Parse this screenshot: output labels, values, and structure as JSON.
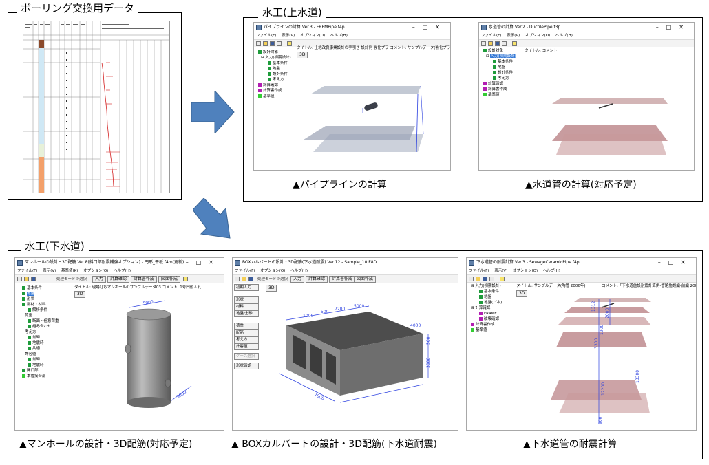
{
  "boring": {
    "title": "ボーリング交換用データ"
  },
  "water_supply": {
    "title": "水工(上水道)",
    "pipeline": {
      "window_title": "パイプラインの計算 Ver.3 - FRPMPipe.f4p",
      "menu": [
        "ファイル(F)",
        "表示(V)",
        "オプション(O)",
        "ヘルプ(H)"
      ],
      "tree": [
        "設計対象",
        "入力(初期設計)",
        "基本条件",
        "地盤",
        "設計条件",
        "考え方",
        "計算確認",
        "計算書作成",
        "基準値"
      ],
      "info_strip": "タイトル: 土地改良事業設計の手引き 設計例  強化プラ  コメント: サンプルデータ(強化プラスチック複合管)",
      "btn_3d": "3D",
      "caption": "▲パイプラインの計算"
    },
    "water_pipe": {
      "window_title": "水道管の計算 Ver.2 - DuctilePipe.f3p",
      "menu": [
        "ファイル(F)",
        "表示(V)",
        "オプション(O)",
        "ヘルプ(H)"
      ],
      "tree": [
        "設計対象",
        "入力(初期設計)",
        "基本条件",
        "地盤",
        "設計条件",
        "考え方",
        "計算確認",
        "計算書作成",
        "基準値"
      ],
      "info_strip": "タイトル:  コメント:",
      "caption": "▲水道管の計算(対応予定)"
    }
  },
  "sewer": {
    "title": "水工(下水道)",
    "manhole": {
      "window_title": "マンホールの設計・3D配筋 Ver.8(斜口部耐震補強オプション) - 円形_平板.f4m(更新)",
      "menu": [
        "ファイル(F)",
        "表示(V)",
        "基準値(K)",
        "オプション(O)",
        "ヘルプ(H)"
      ],
      "mode_label": "処理モードの選択",
      "mode_buttons": [
        "入力",
        "計算確認",
        "計算書作成",
        "図面作成"
      ],
      "info_strip": "タイトル: 現場打ちマンホールのサンプルデータ03  コメント: 1号円形人孔",
      "btn_3d": "3D",
      "tree": [
        "基本条件",
        "地盤",
        "形状",
        "部材・材料",
        "解析条件",
        "荷重",
        "断面・任意荷重",
        "組み合わせ",
        "考え方",
        "常時",
        "地震時",
        "共通",
        "許容値",
        "常時",
        "地震時",
        "開口部",
        "本管接合部"
      ],
      "dims": [
        "5000",
        "3000"
      ],
      "caption": "▲マンホールの設計・3D配筋(対応予定)"
    },
    "box": {
      "window_title": "BOXカルバートの設計・3D配筋(下水道耐震) Ver.12 - Sample_10.F8D",
      "menu": [
        "ファイル(F)",
        "オプション(O)",
        "ヘルプ(H)"
      ],
      "mode_label": "処理モードの選択",
      "mode_buttons": [
        "入力",
        "計算確認",
        "計算書作成",
        "図面作成"
      ],
      "side_buttons": [
        "初期入力",
        "形状",
        "材料",
        "地盤/土砂",
        "荷重",
        "配筋",
        "考え方",
        "許容値",
        "ケース選択",
        "形状確認"
      ],
      "btn_3d": "3D",
      "dims": [
        "1000",
        "500",
        "7200",
        "5000",
        "4000",
        "3000",
        "500",
        "7000"
      ],
      "caption": "▲ BOXカルバートの設計・3D配筋(下水道耐震)"
    },
    "sewer_pipe": {
      "window_title": "下水道管の耐震計算 Ver.3 - SewageCeramicPipe.f4p",
      "menu": [
        "ファイル(F)",
        "表示(V)",
        "オプション(O)",
        "ヘルプ(H)"
      ],
      "tree": [
        "入力(初期設計)",
        "基本条件",
        "地盤",
        "地盤(パネ)",
        "計算確認",
        "FRAME",
        "破壊確認",
        "計算書作成",
        "基準値"
      ],
      "info_strip": "タイトル: サンプルデータ(陶管 2006年)",
      "info_strip2": "コメント:「下水道施設耐震計算例-管路施設編-前編 2001",
      "btn_3d": "3D",
      "dims": [
        "1312",
        "1900",
        "2000",
        "3300",
        "12200",
        "13300",
        "900"
      ],
      "caption": "▲下水道管の耐震計算"
    }
  },
  "colors": {
    "arrow": "#4f81bd",
    "green_check": "#1f9b3b",
    "magenta": "#b21fb2",
    "plane_gray": "#8a96ad",
    "plane_pink": "#b9797c",
    "dim_blue": "#2a3fe0"
  }
}
